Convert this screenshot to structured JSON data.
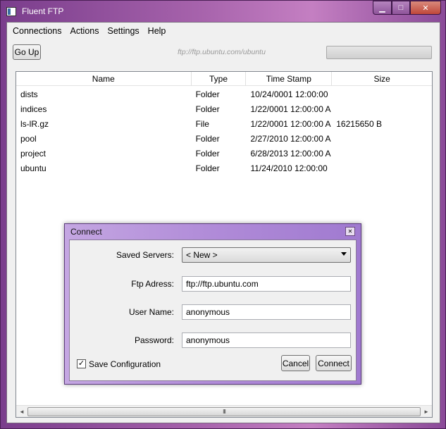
{
  "window": {
    "title": "Fluent FTP",
    "minimize_glyph": "▁",
    "maximize_glyph": "□",
    "close_glyph": "✕"
  },
  "menu": [
    "Connections",
    "Actions",
    "Settings",
    "Help"
  ],
  "toolbar": {
    "go_up_label": "Go Up",
    "path": "ftp://ftp.ubuntu.com/ubuntu",
    "progress": 0
  },
  "list": {
    "columns": [
      "Name",
      "Type",
      "Time Stamp",
      "Size"
    ],
    "rows": [
      {
        "name": "dists",
        "type": "Folder",
        "time": "10/24/0001 12:00:00",
        "size": ""
      },
      {
        "name": "indices",
        "type": "Folder",
        "time": "1/22/0001 12:00:00 A",
        "size": ""
      },
      {
        "name": "ls-lR.gz",
        "type": "File",
        "time": "1/22/0001 12:00:00 A",
        "size": "16215650 B"
      },
      {
        "name": "pool",
        "type": "Folder",
        "time": "2/27/2010 12:00:00 A",
        "size": ""
      },
      {
        "name": "project",
        "type": "Folder",
        "time": "6/28/2013 12:00:00 A",
        "size": ""
      },
      {
        "name": "ubuntu",
        "type": "Folder",
        "time": "11/24/2010 12:00:00",
        "size": ""
      }
    ],
    "scroll_grip": "III",
    "scroll_left_glyph": "◄",
    "scroll_right_glyph": "►"
  },
  "dialog": {
    "title": "Connect",
    "close_glyph": "✕",
    "saved_servers_label": "Saved Servers:",
    "saved_servers_value": "< New >",
    "ftp_address_label": "Ftp Adress:",
    "ftp_address_value": "ftp://ftp.ubuntu.com",
    "user_name_label": "User Name:",
    "user_name_value": "anonymous",
    "password_label": "Password:",
    "password_value": "anonymous",
    "save_config_label": "Save Configuration",
    "save_config_checked": true,
    "check_glyph": "✓",
    "cancel_label": "Cancel",
    "connect_label": "Connect"
  },
  "colors": {
    "progress_fill": "#4fc04f",
    "dialog_frame": "#b08bd8"
  }
}
